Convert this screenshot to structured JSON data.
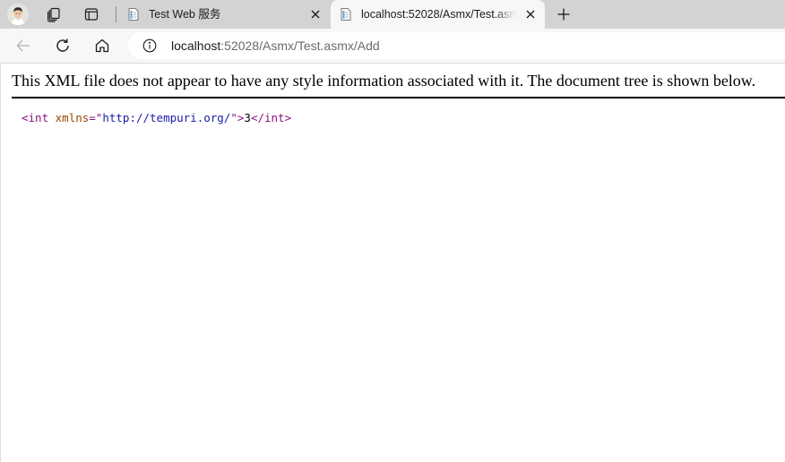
{
  "tabs": [
    {
      "title": "Test Web 服务",
      "active": false,
      "favicon": "page-icon"
    },
    {
      "title": "localhost:52028/Asmx/Test.asmx/Add",
      "active": true,
      "favicon": "page-icon"
    }
  ],
  "toolbar": {
    "url_host": "localhost",
    "url_rest": ":52028/Asmx/Test.asmx/Add"
  },
  "page": {
    "notice": "This XML file does not appear to have any style information associated with it. The document tree is shown below.",
    "xml": {
      "open_tag": "<int",
      "attr_name": "xmlns",
      "attr_eq": "=\"",
      "attr_value": "http://tempuri.org/",
      "attr_close": "\">",
      "text": "3",
      "close_tag": "</int>"
    }
  },
  "icons": {
    "avatar": "profile-avatar-icon",
    "workspaces": "workspaces-icon",
    "tab_actions": "tab-actions-icon",
    "back": "back-arrow-icon",
    "refresh": "refresh-icon",
    "home": "home-icon",
    "info": "info-icon",
    "close": "close-icon",
    "new_tab": "plus-icon"
  }
}
